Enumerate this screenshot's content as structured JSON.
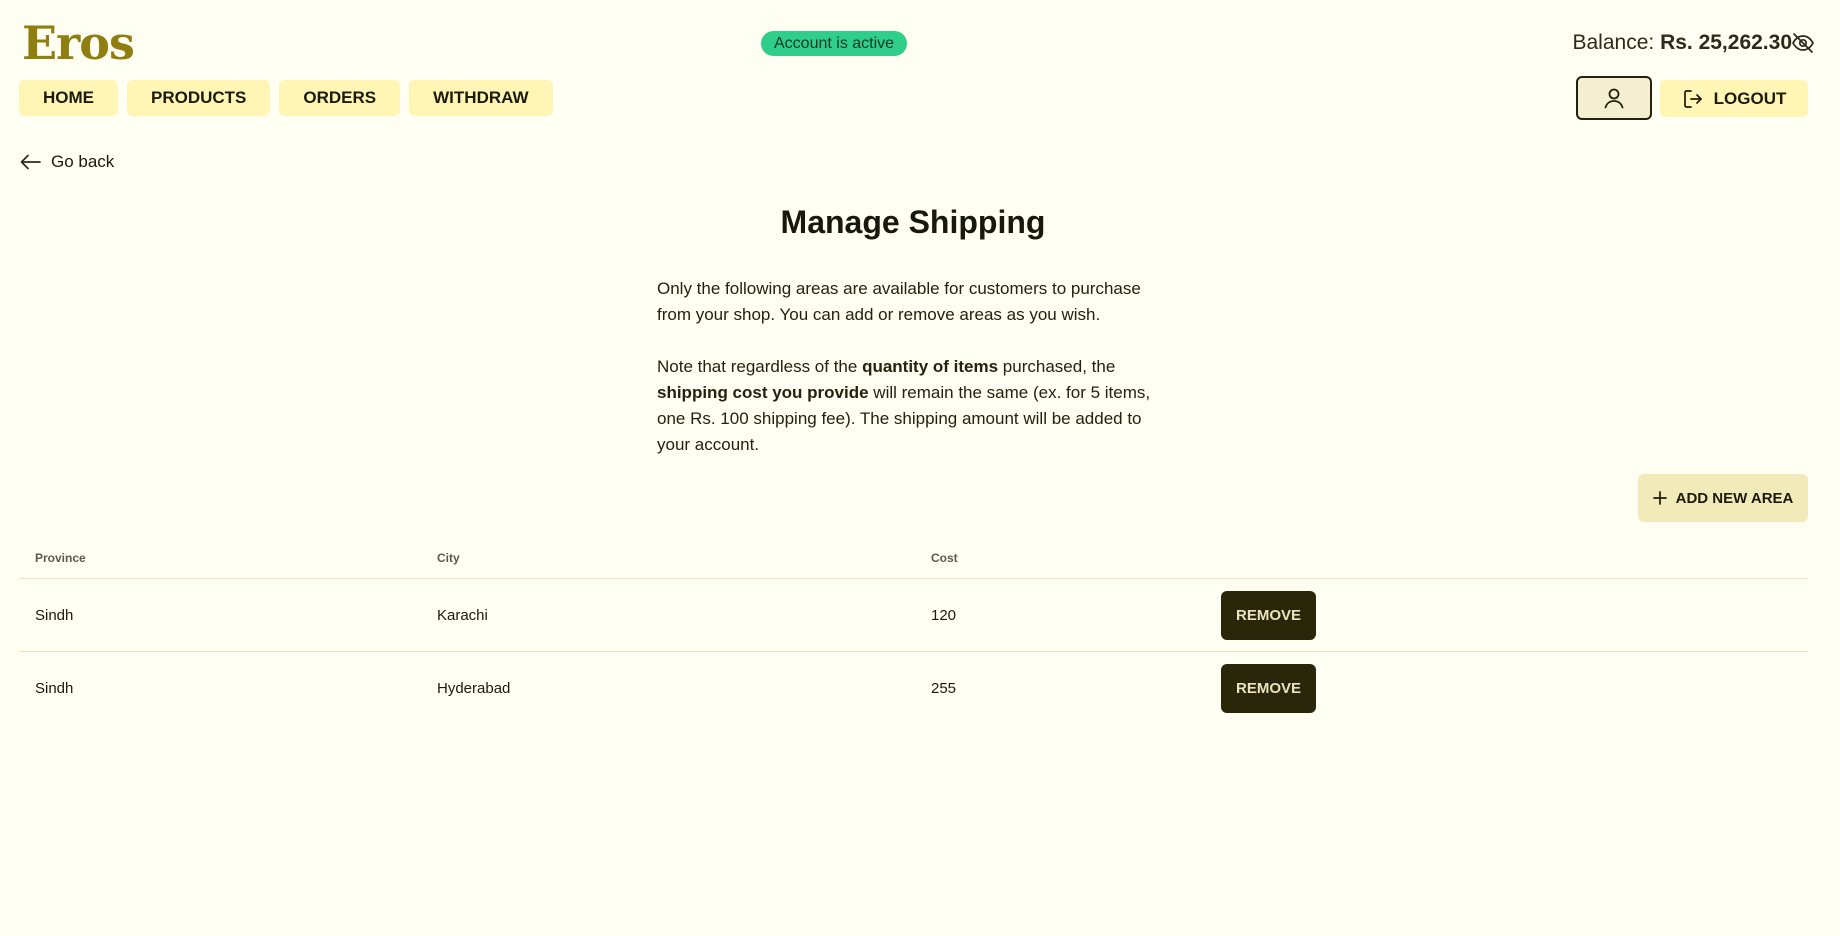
{
  "brand": {
    "logo": "Eros",
    "accent": "#8f7e10"
  },
  "status": {
    "text": "Account is active",
    "color": "#2fce8a"
  },
  "balance": {
    "label": "Balance:",
    "amount": "Rs. 25,262.30",
    "toggle_icon": "eye-off-icon"
  },
  "nav": {
    "items": [
      {
        "label": "HOME"
      },
      {
        "label": "PRODUCTS"
      },
      {
        "label": "ORDERS"
      },
      {
        "label": "WITHDRAW"
      }
    ],
    "profile_icon": "user-icon",
    "logout": {
      "label": "LOGOUT",
      "icon": "logout-icon"
    }
  },
  "back": {
    "label": "Go back",
    "icon": "arrow-left-icon"
  },
  "page": {
    "title": "Manage Shipping",
    "desc1": "Only the following areas are available for customers to purchase from your shop. You can add or remove areas as you wish.",
    "desc2_a": "Note that regardless of the ",
    "desc2_b": "quantity of items",
    "desc2_c": " purchased, the ",
    "desc2_d": "shipping cost you provide",
    "desc2_e": " will remain the same (ex. for 5 items, one Rs. 100 shipping fee). The shipping amount will be added to your account."
  },
  "add_area": {
    "label": "ADD NEW AREA",
    "icon": "plus-icon"
  },
  "table": {
    "headers": {
      "province": "Province",
      "city": "City",
      "cost": "Cost"
    },
    "rows": [
      {
        "province": "Sindh",
        "city": "Karachi",
        "cost": "120",
        "action": "REMOVE"
      },
      {
        "province": "Sindh",
        "city": "Hyderabad",
        "cost": "255",
        "action": "REMOVE"
      }
    ]
  }
}
